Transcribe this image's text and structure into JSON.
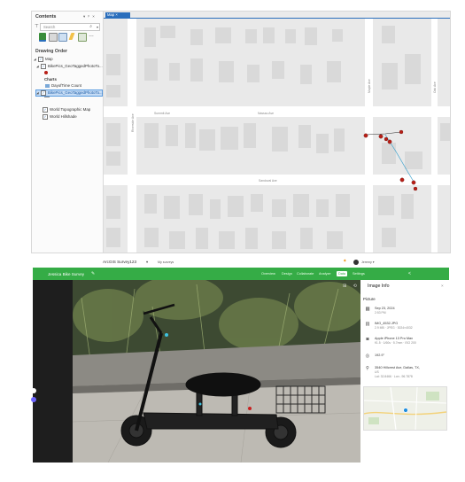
{
  "arcgis_pro": {
    "contents_panel": {
      "title": "Contents",
      "header_controls": "▾ ᵖ ×",
      "search_placeholder": "Search",
      "drawing_order_label": "Drawing Order",
      "tree": [
        {
          "label": "Map",
          "level": 0,
          "checked": true
        },
        {
          "label": "BikePics_GeoTaggedPhotoTo...",
          "level": 1,
          "checked": true
        },
        {
          "label": "Charts",
          "level": 2,
          "checked": false
        },
        {
          "label": "DayofTime Count",
          "level": 3,
          "checked": false
        },
        {
          "label": "BikePics_GeoTaggedPhotoTo...",
          "level": 1,
          "checked": true,
          "selected": true
        },
        {
          "label": "World Topographic Map",
          "level": 1,
          "checked": true
        },
        {
          "label": "World Hillshade",
          "level": 1,
          "checked": true
        }
      ]
    },
    "map_tab_label": "Map",
    "street_labels": [
      {
        "text": "Summit Ave",
        "orientation": "horizontal"
      },
      {
        "text": "Nassau Ave",
        "orientation": "horizontal"
      },
      {
        "text": "Sandoval Ave",
        "orientation": "horizontal"
      },
      {
        "text": "Riverside Ave",
        "orientation": "vertical"
      },
      {
        "text": "Maple Ave",
        "orientation": "vertical"
      },
      {
        "text": "Oak Ave",
        "orientation": "vertical"
      }
    ]
  },
  "survey123": {
    "app_title": "ArcGIS Survey123",
    "app_title_caret": "▾",
    "owner_label": "My surveys",
    "user_name": "Jeremy ▾",
    "survey_name": "Jessica Bike Survey",
    "nav_items": [
      "Overview",
      "Design",
      "Collaborate",
      "Analyze",
      "Data",
      "Settings"
    ],
    "active_nav": "Data",
    "image_info": {
      "title": "Image Info",
      "picture_label": "Picture",
      "rows": [
        {
          "icon": "calendar-icon",
          "line1": "Sep 23, 2024",
          "line2": "2:53 PM"
        },
        {
          "icon": "file-icon",
          "line1": "IMG_4532.JPG",
          "line2": "2.9 MB · JPEG · 3024×4032"
        },
        {
          "icon": "camera-icon",
          "line1": "Apple iPhone 13 Pro Max",
          "line2": "f/1.5 · 1/60s · 5.7mm · ISO 200"
        },
        {
          "icon": "compass-icon",
          "line1": "192.9°",
          "line2": ""
        },
        {
          "icon": "location-icon",
          "line1": "3540 Hillcrest Ave, Dallas, TX,",
          "line2": "US"
        },
        {
          "icon": "coords",
          "line1": "",
          "line2": "Lat: 32.8466 · Lon: -96.7878"
        }
      ]
    }
  },
  "colors": {
    "accent_blue": "#2a6ebc",
    "survey_green": "#35ac46",
    "point_red": "#b81f17",
    "track_cyan": "#3aa0cc"
  }
}
